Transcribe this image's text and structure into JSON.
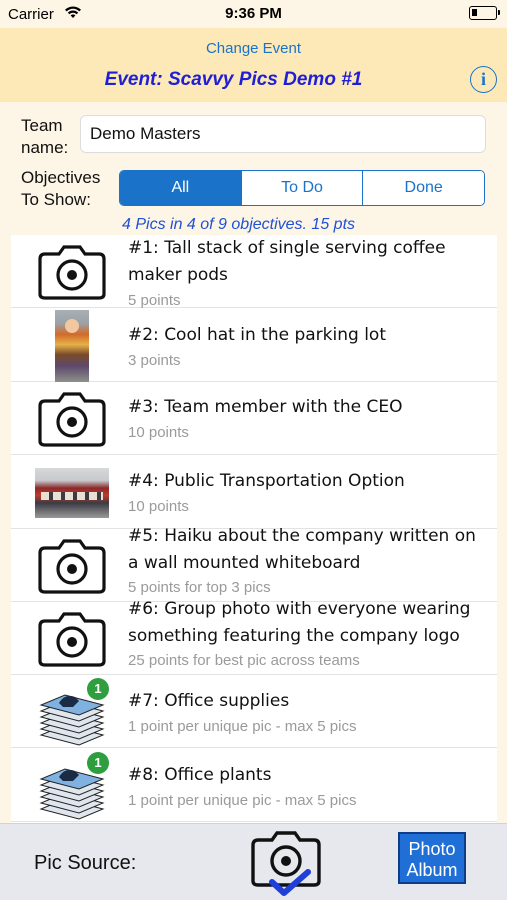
{
  "status": {
    "carrier": "Carrier",
    "time": "9:36 PM"
  },
  "nav": {
    "change_event": "Change Event",
    "event_title": "Event: Scavvy Pics Demo #1",
    "info": "i"
  },
  "team": {
    "label": "Team name:",
    "value": "Demo Masters"
  },
  "objectives": {
    "label": "Objectives To Show:",
    "filters": [
      "All",
      "To Do",
      "Done"
    ],
    "selected": "All"
  },
  "summary": "4 Pics in 4 of 9 objectives.  15 pts",
  "items": [
    {
      "title": "#1: Tall stack of single serving coffee maker pods",
      "points": "5 points",
      "thumb": "camera-icon"
    },
    {
      "title": "#2: Cool hat in the parking lot",
      "points": "3 points",
      "thumb": "photo"
    },
    {
      "title": "#3: Team member with the CEO",
      "points": "10 points",
      "thumb": "camera-icon"
    },
    {
      "title": "#4: Public Transportation Option",
      "points": "10 points",
      "thumb": "photo"
    },
    {
      "title": "#5: Haiku about the company written on a wall mounted whiteboard",
      "points": "5 points for top 3 pics",
      "thumb": "camera-icon"
    },
    {
      "title": "#6: Group photo with everyone wearing something featuring the company logo",
      "points": "25 points for best pic across teams",
      "thumb": "camera-icon"
    },
    {
      "title": "#7: Office supplies",
      "points": "1 point per unique pic - max 5 pics",
      "thumb": "photo-stack-icon",
      "badge": "1"
    },
    {
      "title": "#8: Office plants",
      "points": "1 point per unique pic - max 5 pics",
      "thumb": "photo-stack-icon",
      "badge": "1"
    }
  ],
  "bottom": {
    "pic_source_label": "Pic Source:",
    "album_line1": "Photo",
    "album_line2": "Album"
  },
  "colors": {
    "accent": "#1a73c8",
    "nav_bg": "#fde8b8",
    "page_bg": "#fdf6e6",
    "title_blue": "#1f1fd6",
    "badge_green": "#2e9e3e"
  }
}
